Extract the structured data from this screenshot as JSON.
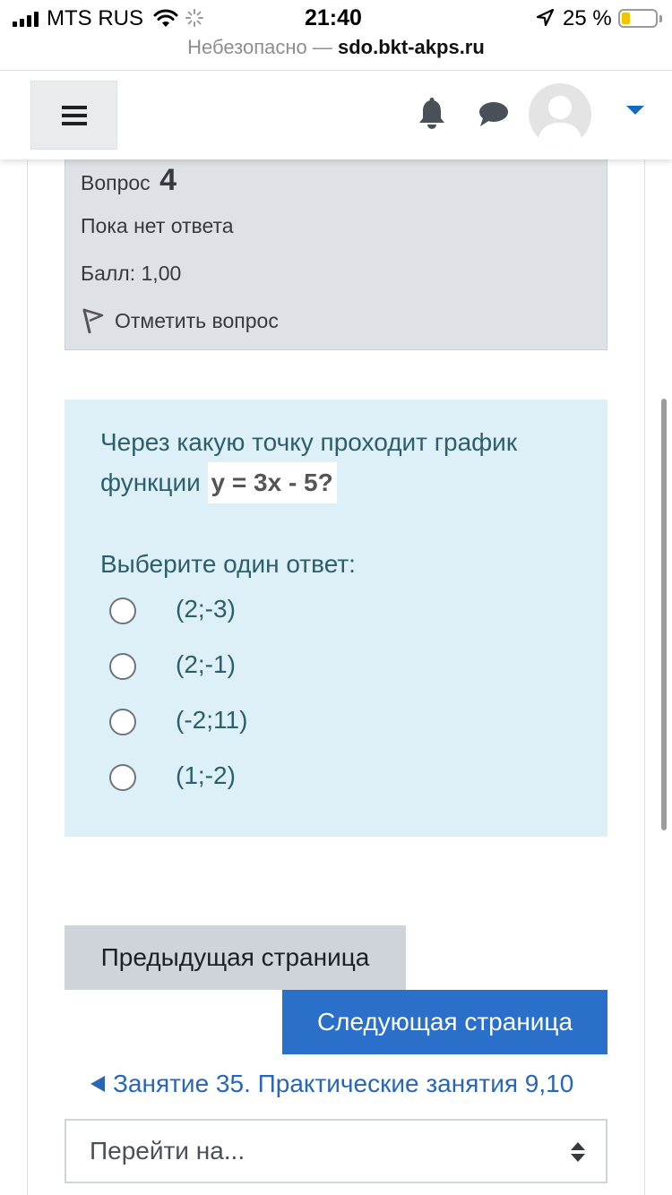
{
  "status_bar": {
    "carrier": "MTS RUS",
    "time": "21:40",
    "battery_percent": "25 %",
    "battery_level": 0.25,
    "battery_color": "#f5c400"
  },
  "browser": {
    "insecure_label": "Небезопасно —",
    "host": "sdo.bkt-akps.ru"
  },
  "navbar": {
    "menu_icon": "hamburger-icon",
    "notification_icon": "bell-icon",
    "messages_icon": "chat-icon",
    "user_menu_icon": "caret-down-icon",
    "accent_color": "#0f6cbf"
  },
  "question_info": {
    "label": "Вопрос",
    "number": "4",
    "state": "Пока нет ответа",
    "grade": "Балл: 1,00",
    "flag_label": "Отметить вопрос",
    "flag_icon": "flag-icon"
  },
  "question": {
    "text": "Через какую точку проходит график функции",
    "formula": "y = 3x - 5?",
    "prompt": "Выберите один ответ:",
    "answers": [
      {
        "label": "(2;-3)",
        "selected": false
      },
      {
        "label": "(2;-1)",
        "selected": false
      },
      {
        "label": "(-2;11)",
        "selected": false
      },
      {
        "label": "(1;-2)",
        "selected": false
      }
    ]
  },
  "navigation": {
    "prev_button": "Предыдущая страница",
    "next_button": "Следующая страница",
    "prev_activity_link": "Занятие 35. Практические занятия 9,10",
    "prev_activity_icon": "triangle-left-icon",
    "jump_select": "Перейти на...",
    "jump_icon": "select-arrows-icon"
  }
}
